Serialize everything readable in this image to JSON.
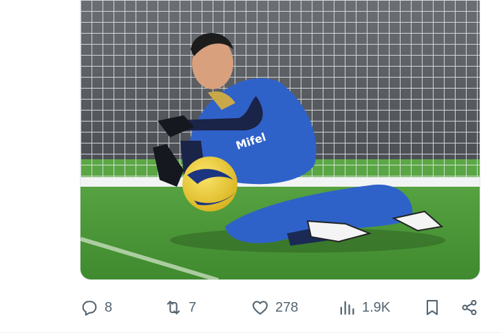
{
  "post": {
    "media": {
      "alt_icon": "photo",
      "colors": {
        "net_bg": "#5a5e63",
        "grass": "#4f9a3a",
        "kit_blue": "#2d5fc6",
        "ball_yellow": "#f0d33a"
      }
    },
    "actions": {
      "reply": {
        "icon": "speech-bubble-icon",
        "count": "8"
      },
      "repost": {
        "icon": "repost-icon",
        "count": "7"
      },
      "like": {
        "icon": "heart-icon",
        "count": "278"
      },
      "views": {
        "icon": "bar-chart-icon",
        "count": "1.9K"
      },
      "bookmark": {
        "icon": "bookmark-icon"
      },
      "share": {
        "icon": "share-icon"
      }
    },
    "colors": {
      "icon_gray": "#536471"
    }
  }
}
